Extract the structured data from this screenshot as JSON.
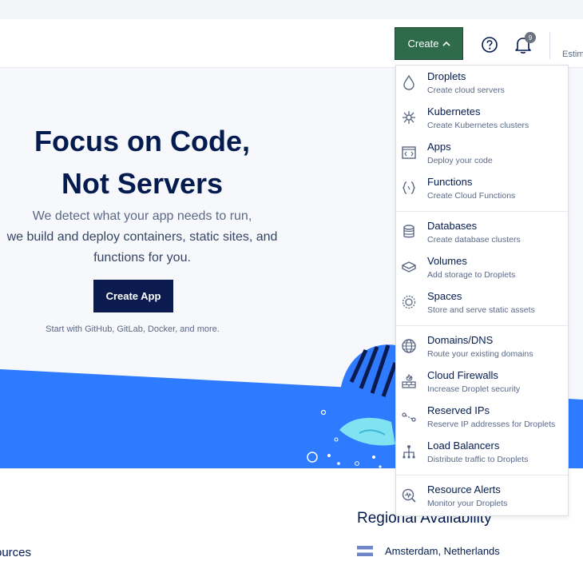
{
  "header": {
    "create_label": "Create",
    "notification_count": "9",
    "estimate_text": "Estim"
  },
  "hero": {
    "title_line1": "Focus on Code,",
    "title_line2": "Not Servers",
    "sub_line1": "We detect what your app needs to run,",
    "sub_line2": "we build and deploy containers, static sites, and",
    "sub_line3": "functions for you.",
    "create_app_label": "Create App",
    "start_with": "Start with GitHub, GitLab, Docker, and more."
  },
  "bottom": {
    "regional_title": "Regional Availability",
    "region_name": "Amsterdam, Netherlands",
    "resources_label": "ources"
  },
  "menu": {
    "items": [
      {
        "title": "Droplets",
        "desc": "Create cloud servers",
        "icon": "droplet-icon"
      },
      {
        "title": "Kubernetes",
        "desc": "Create Kubernetes clusters",
        "icon": "kubernetes-icon"
      },
      {
        "title": "Apps",
        "desc": "Deploy your code",
        "icon": "apps-icon"
      },
      {
        "title": "Functions",
        "desc": "Create Cloud Functions",
        "icon": "functions-icon"
      },
      {
        "title": "Databases",
        "desc": "Create database clusters",
        "icon": "database-icon"
      },
      {
        "title": "Volumes",
        "desc": "Add storage to Droplets",
        "icon": "volume-icon"
      },
      {
        "title": "Spaces",
        "desc": "Store and serve static assets",
        "icon": "spaces-icon"
      },
      {
        "title": "Domains/DNS",
        "desc": "Route your existing domains",
        "icon": "globe-icon"
      },
      {
        "title": "Cloud Firewalls",
        "desc": "Increase Droplet security",
        "icon": "firewall-icon"
      },
      {
        "title": "Reserved IPs",
        "desc": "Reserve IP addresses for Droplets",
        "icon": "reserved-ip-icon"
      },
      {
        "title": "Load Balancers",
        "desc": "Distribute traffic to Droplets",
        "icon": "load-balancer-icon"
      },
      {
        "title": "Resource Alerts",
        "desc": "Monitor your Droplets",
        "icon": "resource-alerts-icon"
      }
    ]
  },
  "colors": {
    "create_button": "#2f6b4a",
    "primary_navy": "#0b1a4f",
    "hero_blue": "#2f7bff"
  }
}
